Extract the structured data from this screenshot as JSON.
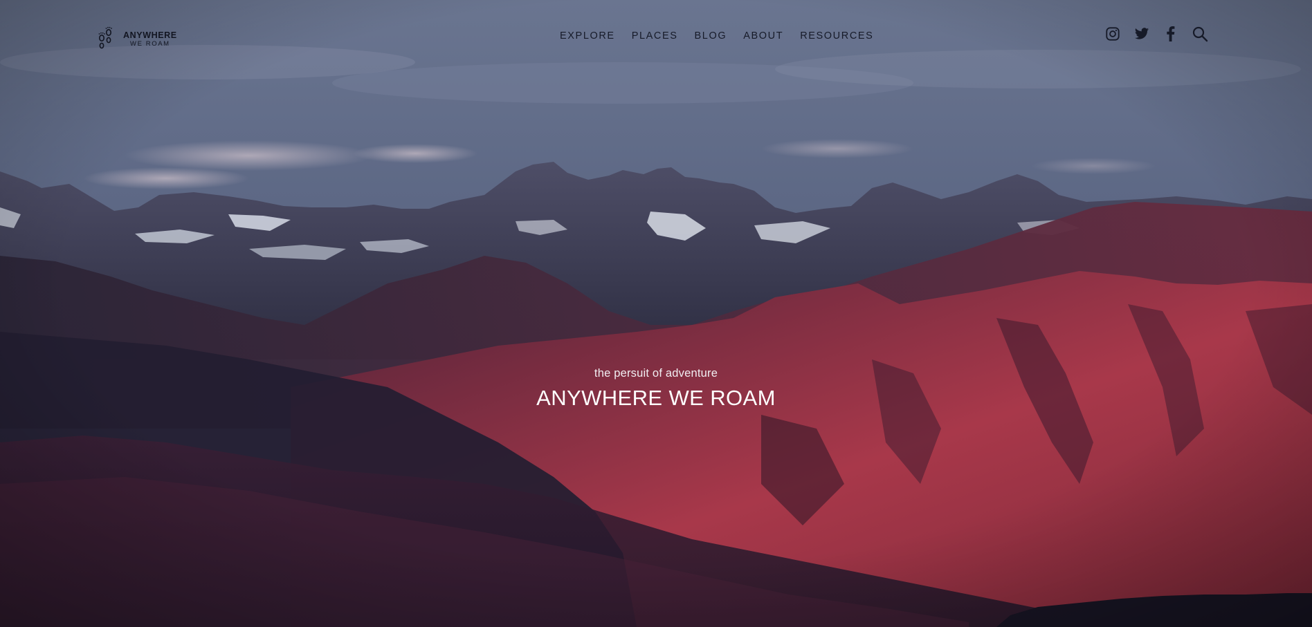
{
  "header": {
    "logo": {
      "line1": "ANYWHERE",
      "line2": "WE ROAM",
      "icon": "footprints-icon"
    },
    "nav": [
      {
        "label": "EXPLORE"
      },
      {
        "label": "PLACES"
      },
      {
        "label": "BLOG"
      },
      {
        "label": "ABOUT"
      },
      {
        "label": "RESOURCES"
      }
    ],
    "social": [
      {
        "icon": "instagram-icon"
      },
      {
        "icon": "twitter-icon"
      },
      {
        "icon": "facebook-icon"
      },
      {
        "icon": "search-icon"
      }
    ]
  },
  "hero": {
    "tagline": "the persuit of adventure",
    "title": "ANYWHERE WE ROAM",
    "image": "mountain-range-photo"
  },
  "colors": {
    "nav_text": "#161a28",
    "hero_text": "#ffffff",
    "sky": "#5e6884",
    "mountain_red": "#9a3146",
    "shadow": "#1b1a2b"
  }
}
